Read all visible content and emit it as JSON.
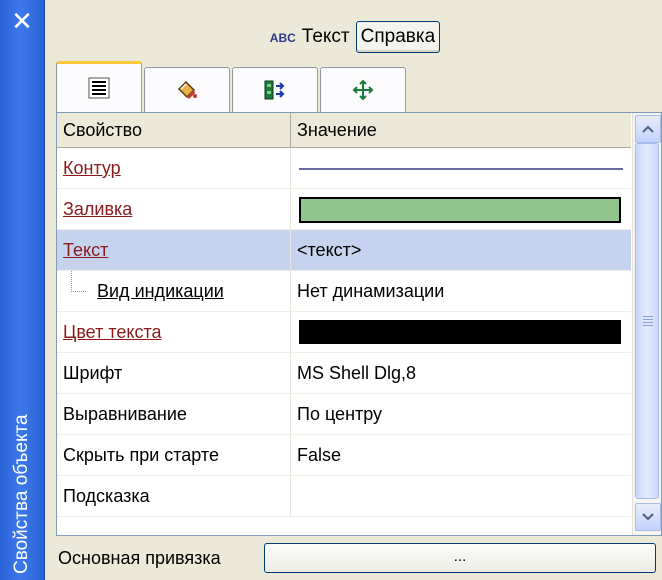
{
  "window": {
    "side_title": "Свойства объекта",
    "close_symbol": "✕"
  },
  "header": {
    "icon_text": "ABC",
    "title": "Текст",
    "help_label": "Справка"
  },
  "tabs": [
    {
      "icon": "list-lines-icon",
      "active": true
    },
    {
      "icon": "paint-bucket-icon",
      "active": false
    },
    {
      "icon": "link-arrows-icon",
      "active": false
    },
    {
      "icon": "move-arrows-icon",
      "active": false
    }
  ],
  "grid": {
    "columns": [
      "Свойство",
      "Значение"
    ],
    "rows": [
      {
        "property": "Контур",
        "value": "",
        "kind": "line",
        "color": "#6a6aa0"
      },
      {
        "property": "Заливка",
        "value": "",
        "kind": "swatch",
        "color": "#8fc48f"
      },
      {
        "property": "Текст",
        "value": "<текст>",
        "kind": "text",
        "selected": true
      },
      {
        "property": "Вид индикации",
        "value": "Нет динамизации",
        "kind": "child"
      },
      {
        "property": "Цвет текста",
        "value": "",
        "kind": "color",
        "color": "#000000"
      },
      {
        "property": "Шрифт",
        "value": "MS Shell Dlg,8",
        "kind": "plain"
      },
      {
        "property": "Выравнивание",
        "value": "По центру",
        "kind": "plain"
      },
      {
        "property": "Скрыть при старте",
        "value": "False",
        "kind": "plain"
      },
      {
        "property": "Подсказка",
        "value": "",
        "kind": "plain"
      }
    ]
  },
  "footer": {
    "label": "Основная привязка",
    "button_label": "..."
  }
}
